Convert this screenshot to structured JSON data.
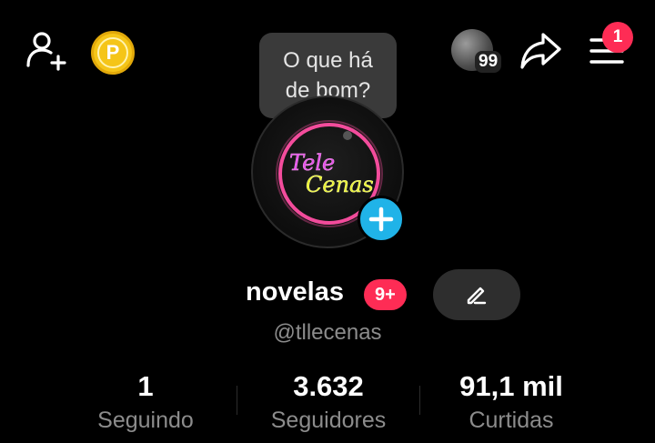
{
  "header": {
    "add_friend_icon": "add-user-icon",
    "coin_letter": "P",
    "visitors_count": "99",
    "share_icon": "share-icon",
    "menu_icon": "menu-icon",
    "menu_badge": "1"
  },
  "tooltip": {
    "line1": "O que há",
    "line2": "de bom?"
  },
  "profile": {
    "avatar_text": [
      "Tele",
      "Cenas"
    ],
    "name": "novelas",
    "name_badge": "9+",
    "handle": "@tllecenas"
  },
  "stats": [
    {
      "value": "1",
      "label": "Seguindo"
    },
    {
      "value": "3.632",
      "label": "Seguidores"
    },
    {
      "value": "91,1 mil",
      "label": "Curtidas"
    }
  ],
  "colors": {
    "background": "#000000",
    "accent_red": "#fe2c55",
    "accent_blue": "#20b3e8",
    "coin_gold": "#f5c518",
    "muted_text": "#8c8c8c"
  }
}
